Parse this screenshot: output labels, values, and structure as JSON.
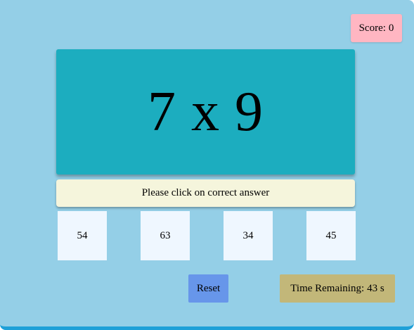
{
  "score": {
    "label": "Score:",
    "value": "0"
  },
  "question": {
    "text": "7 x 9"
  },
  "instruction": "Please click on correct answer",
  "choices": [
    "54",
    "63",
    "34",
    "45"
  ],
  "reset_label": "Reset",
  "time": {
    "label": "Time Remaining:",
    "value": "43 s"
  },
  "colors": {
    "background": "#94cfe7",
    "bottom_border": "#1ea0d8",
    "score_box": "#ffb6c2",
    "question_box": "#1cadbf",
    "instruction_box": "#f5f5dc",
    "choice_box": "#eff7ff",
    "reset_button": "#6796ea",
    "time_box": "#c2b779"
  }
}
